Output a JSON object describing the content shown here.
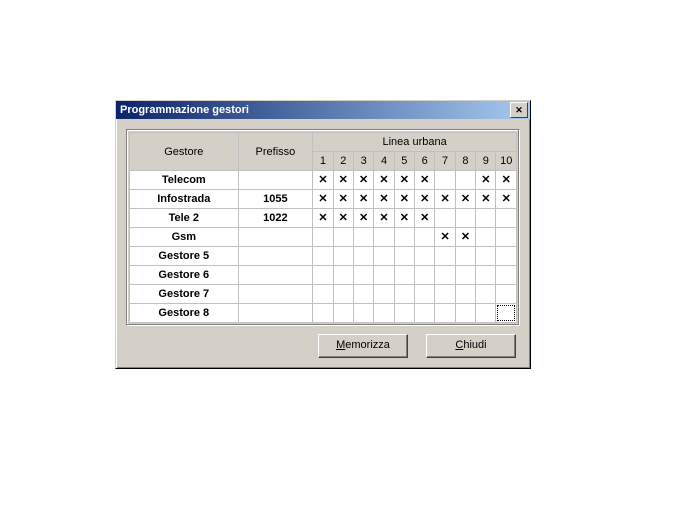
{
  "window": {
    "title": "Programmazione gestori"
  },
  "headers": {
    "gestore": "Gestore",
    "prefisso": "Prefisso",
    "linea_urbana": "Linea urbana",
    "lines": [
      "1",
      "2",
      "3",
      "4",
      "5",
      "6",
      "7",
      "8",
      "9",
      "10"
    ]
  },
  "rows": [
    {
      "gestore": "Telecom",
      "prefisso": "",
      "cells": [
        true,
        true,
        true,
        true,
        true,
        true,
        false,
        false,
        true,
        true
      ]
    },
    {
      "gestore": "Infostrada",
      "prefisso": "1055",
      "cells": [
        true,
        true,
        true,
        true,
        true,
        true,
        true,
        true,
        true,
        true
      ]
    },
    {
      "gestore": "Tele 2",
      "prefisso": "1022",
      "cells": [
        true,
        true,
        true,
        true,
        true,
        true,
        false,
        false,
        false,
        false
      ]
    },
    {
      "gestore": "Gsm",
      "prefisso": "",
      "cells": [
        false,
        false,
        false,
        false,
        false,
        false,
        true,
        true,
        false,
        false
      ]
    },
    {
      "gestore": "Gestore 5",
      "prefisso": "",
      "cells": [
        false,
        false,
        false,
        false,
        false,
        false,
        false,
        false,
        false,
        false
      ]
    },
    {
      "gestore": "Gestore 6",
      "prefisso": "",
      "cells": [
        false,
        false,
        false,
        false,
        false,
        false,
        false,
        false,
        false,
        false
      ]
    },
    {
      "gestore": "Gestore 7",
      "prefisso": "",
      "cells": [
        false,
        false,
        false,
        false,
        false,
        false,
        false,
        false,
        false,
        false
      ]
    },
    {
      "gestore": "Gestore 8",
      "prefisso": "",
      "cells": [
        false,
        false,
        false,
        false,
        false,
        false,
        false,
        false,
        false,
        false
      ]
    }
  ],
  "focus": {
    "row": 7,
    "col": 9
  },
  "buttons": {
    "memorizza": "Memorizza",
    "chiudi": "Chiudi"
  }
}
